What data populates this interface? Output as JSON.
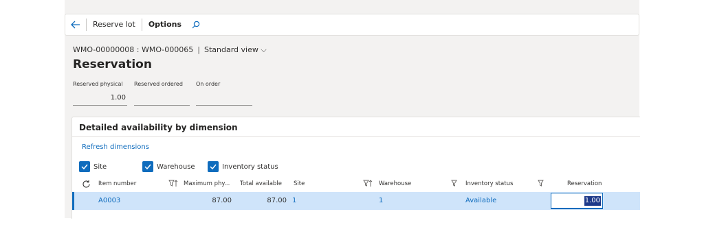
{
  "toolbar": {
    "back_icon": "back-arrow-icon",
    "reserve_lot": "Reserve lot",
    "options": "Options",
    "search_icon": "search-icon"
  },
  "breadcrumb": {
    "record": "WMO-00000008 : WMO-000065",
    "separator": "|",
    "view": "Standard view",
    "chevron": "⌵"
  },
  "page_title": "Reservation",
  "fields": [
    {
      "label": "Reserved physical",
      "value": "1.00"
    },
    {
      "label": "Reserved ordered",
      "value": ""
    },
    {
      "label": "On order",
      "value": ""
    }
  ],
  "section": {
    "title": "Detailed availability by dimension",
    "refresh": "Refresh dimensions",
    "checkboxes": [
      {
        "label": "Site",
        "checked": true
      },
      {
        "label": "Warehouse",
        "checked": true
      },
      {
        "label": "Inventory status",
        "checked": true
      }
    ]
  },
  "grid": {
    "columns": [
      "Item number",
      "Maximum phy...",
      "Total available",
      "Site",
      "Warehouse",
      "Inventory status",
      "Reservation"
    ],
    "rows": [
      {
        "item": "A0003",
        "max_phy": "87.00",
        "total": "87.00",
        "site": "1",
        "warehouse": "1",
        "status": "Available",
        "reservation": "1.00"
      }
    ]
  },
  "colors": {
    "accent": "#0f6cbd",
    "selected_row": "#cfe4fa",
    "background": "#f3f2f1"
  }
}
